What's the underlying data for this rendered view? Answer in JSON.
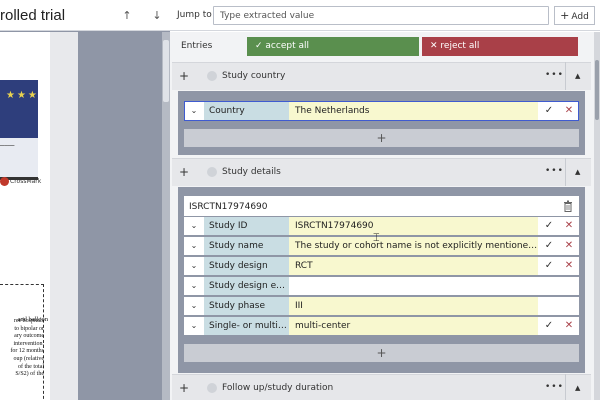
{
  "document": {
    "title_visible": "rolled trial",
    "prev_icon": "arrow-up-icon",
    "next_icon": "arrow-down-icon",
    "crossmark": "CrossMark",
    "text_first": "and balloon",
    "text_lines": [
      "ree hospitals",
      "to bipolar or",
      "ary outcome",
      "intervention.",
      "for 12 months",
      "oup (relative",
      "of the total",
      "S/S2) of the"
    ]
  },
  "toolbar": {
    "jump_label": "Jump to",
    "jump_placeholder": "Type extracted value",
    "add_label": "Add"
  },
  "entries": {
    "label": "Entries",
    "accept_all": "accept all",
    "reject_all": "reject all"
  },
  "sections": {
    "study_country": {
      "title": "Study country",
      "fields": [
        {
          "label": "Country",
          "value": "The Netherlands"
        }
      ]
    },
    "study_details": {
      "title": "Study details",
      "entry_title": "ISRCTN17974690",
      "fields": [
        {
          "label": "Study ID",
          "value": "ISRCTN17974690"
        },
        {
          "label": "Study name",
          "value": "The study or cohort name is not explicitly mentioned in the pr..."
        },
        {
          "label": "Study design",
          "value": "RCT"
        },
        {
          "label": "Study design expl...",
          "value": ""
        },
        {
          "label": "Study phase",
          "value": "III"
        },
        {
          "label": "Single- or multi-c...",
          "value": "multi-center"
        }
      ]
    },
    "follow_up": {
      "title": "Follow up/study duration"
    }
  },
  "icons": {
    "accept": "check-icon",
    "reject": "close-icon",
    "more": "more-icon",
    "collapse": "chevron-up-icon",
    "expand_row": "chevron-down-icon",
    "add": "plus-icon",
    "delete": "trash-icon"
  },
  "colors": {
    "accept": "#5a8f4e",
    "reject": "#a94048",
    "label_bg": "#c9dde3",
    "value_bg": "#f8f8cf"
  }
}
